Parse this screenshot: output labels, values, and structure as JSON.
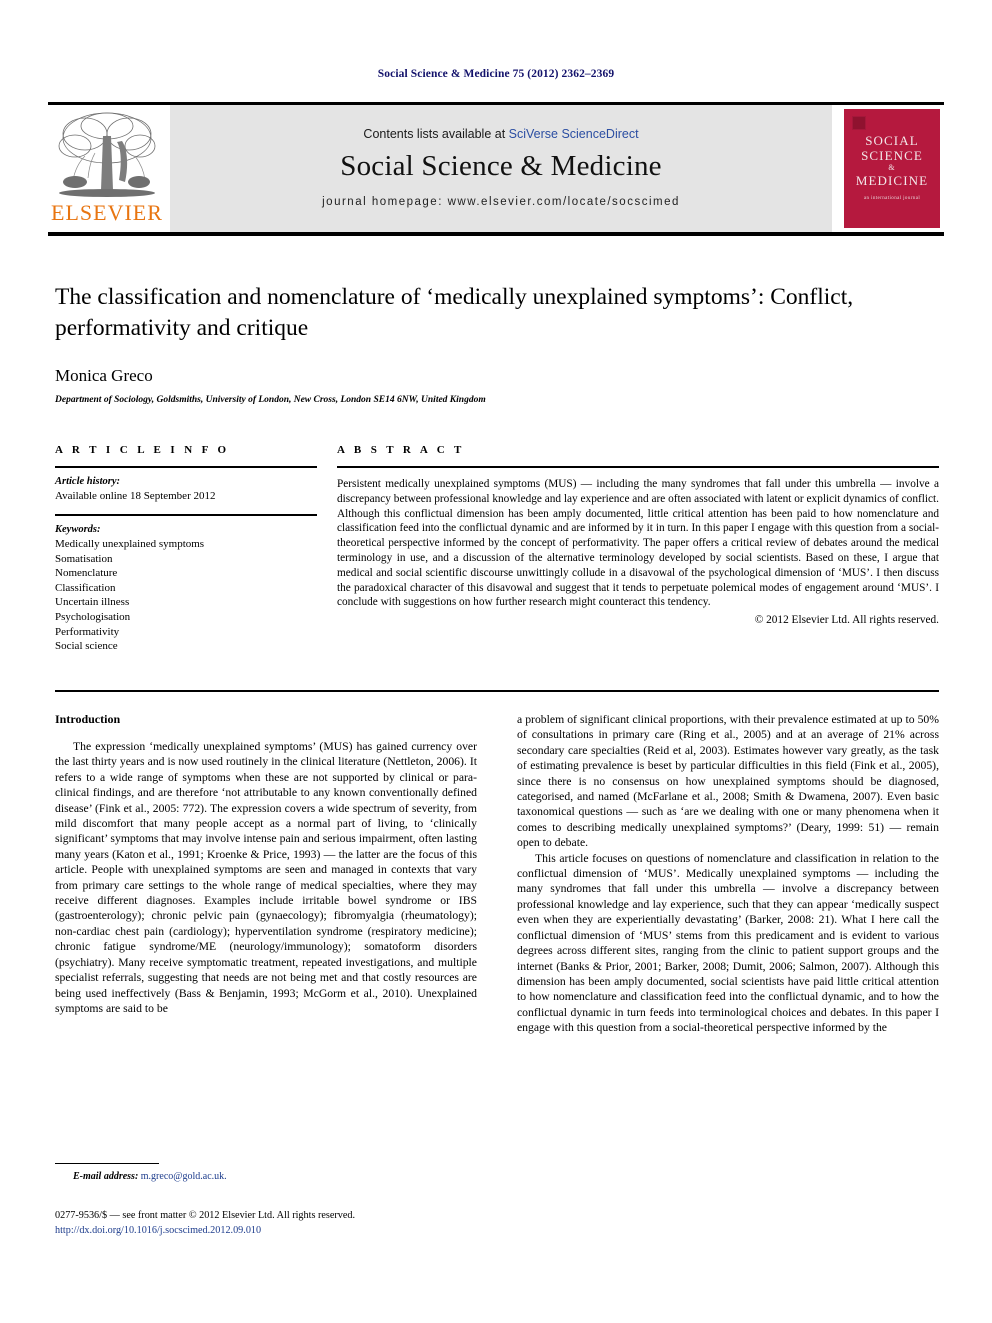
{
  "running_head": "Social Science & Medicine 75 (2012) 2362–2369",
  "masthead": {
    "publisher_logo_label": "ELSEVIER",
    "contents_prefix": "Contents lists available at ",
    "sciencedirect_link": "SciVerse ScienceDirect",
    "journal_name": "Social Science & Medicine",
    "homepage_line": "journal homepage: www.elsevier.com/locate/socscimed",
    "cover": {
      "line1": "SOCIAL",
      "line2": "SCIENCE",
      "amp": "&",
      "line3": "MEDICINE",
      "subtitle": "an international journal"
    },
    "colors": {
      "banner_gray": "#e4e4e4",
      "elsevier_orange": "#e87511",
      "cover_red": "#b5193e",
      "link_blue": "#2b4ea2",
      "running_head_navy": "#13126b",
      "citation_blue": "#1d3c8c"
    }
  },
  "title_block": {
    "title": "The classification and nomenclature of ‘medically unexplained symptoms’: Conflict, performativity and critique",
    "author": "Monica Greco",
    "affiliation": "Department of Sociology, Goldsmiths, University of London, New Cross, London SE14 6NW, United Kingdom"
  },
  "article_info": {
    "heading": "A R T I C L E   I N F O",
    "history_label": "Article history:",
    "history_value": "Available online 18 September 2012",
    "keywords_label": "Keywords:",
    "keywords": [
      "Medically unexplained symptoms",
      "Somatisation",
      "Nomenclature",
      "Classification",
      "Uncertain illness",
      "Psychologisation",
      "Performativity",
      "Social science"
    ]
  },
  "abstract": {
    "heading": "A B S T R A C T",
    "text": "Persistent medically unexplained symptoms (MUS) — including the many syndromes that fall under this umbrella — involve a discrepancy between professional knowledge and lay experience and are often associated with latent or explicit dynamics of conflict. Although this conflictual dimension has been amply documented, little critical attention has been paid to how nomenclature and classification feed into the conflictual dynamic and are informed by it in turn. In this paper I engage with this question from a social-theoretical perspective informed by the concept of performativity. The paper offers a critical review of debates around the medical terminology in use, and a discussion of the alternative terminology developed by social scientists. Based on these, I argue that medical and social scientific discourse unwittingly collude in a disavowal of the psychological dimension of ‘MUS’. I then discuss the paradoxical character of this disavowal and suggest that it tends to perpetuate polemical modes of engagement around ‘MUS’. I conclude with suggestions on how further research might counteract this tendency.",
    "copyright": "© 2012 Elsevier Ltd. All rights reserved."
  },
  "body": {
    "section_heading": "Introduction",
    "left_paragraphs": [
      "The expression ‘medically unexplained symptoms’ (MUS) has gained currency over the last thirty years and is now used routinely in the clinical literature (Nettleton, 2006). It refers to a wide range of symptoms when these are not supported by clinical or para-clinical findings, and are therefore ‘not attributable to any known conventionally defined disease’ (Fink et al., 2005: 772). The expression covers a wide spectrum of severity, from mild discomfort that many people accept as a normal part of living, to ‘clinically significant’ symptoms that may involve intense pain and serious impairment, often lasting many years (Katon et al., 1991; Kroenke & Price, 1993) — the latter are the focus of this article. People with unexplained symptoms are seen and managed in contexts that vary from primary care settings to the whole range of medical specialties, where they may receive different diagnoses. Examples include irritable bowel syndrome or IBS (gastroenterology); chronic pelvic pain (gynaecology); fibromyalgia (rheumatology); non-cardiac chest pain (cardiology); hyperventilation syndrome (respiratory medicine); chronic fatigue syndrome/ME (neurology/immunology); somatoform disorders (psychiatry). Many receive symptomatic treatment, repeated investigations, and multiple specialist referrals, suggesting that needs are not being met and that costly resources are being used ineffectively (Bass & Benjamin, 1993; McGorm et al., 2010). Unexplained symptoms are said to be"
    ],
    "right_paragraphs": [
      "a problem of significant clinical proportions, with their prevalence estimated at up to 50% of consultations in primary care (Ring et al., 2005) and at an average of 21% across secondary care specialties (Reid et al, 2003). Estimates however vary greatly, as the task of estimating prevalence is beset by particular difficulties in this field (Fink et al., 2005), since there is no consensus on how unexplained symptoms should be diagnosed, categorised, and named (McFarlane et al., 2008; Smith & Dwamena, 2007). Even basic taxonomical questions — such as ‘are we dealing with one or many phenomena when it comes to describing medically unexplained symptoms?’ (Deary, 1999: 51) — remain open to debate.",
      "This article focuses on questions of nomenclature and classification in relation to the conflictual dimension of ‘MUS’. Medically unexplained symptoms — including the many syndromes that fall under this umbrella — involve a discrepancy between professional knowledge and lay experience, such that they can appear ‘medically suspect even when they are experientially devastating’ (Barker, 2008: 21). What I here call the conflictual dimension of ‘MUS’ stems from this predicament and is evident to various degrees across different sites, ranging from the clinic to patient support groups and the internet (Banks & Prior, 2001; Barker, 2008; Dumit, 2006; Salmon, 2007). Although this dimension has been amply documented, social scientists have paid little critical attention to how nomenclature and classification feed into the conflictual dynamic, and to how the conflictual dynamic in turn feeds into terminological choices and debates. In this paper I engage with this question from a social-theoretical perspective informed by the"
    ]
  },
  "footnote": {
    "label": "E-mail address:",
    "email": "m.greco@gold.ac.uk."
  },
  "footer": {
    "issn_line": "0277-9536/$ — see front matter © 2012 Elsevier Ltd. All rights reserved.",
    "doi": "http://dx.doi.org/10.1016/j.socscimed.2012.09.010"
  }
}
